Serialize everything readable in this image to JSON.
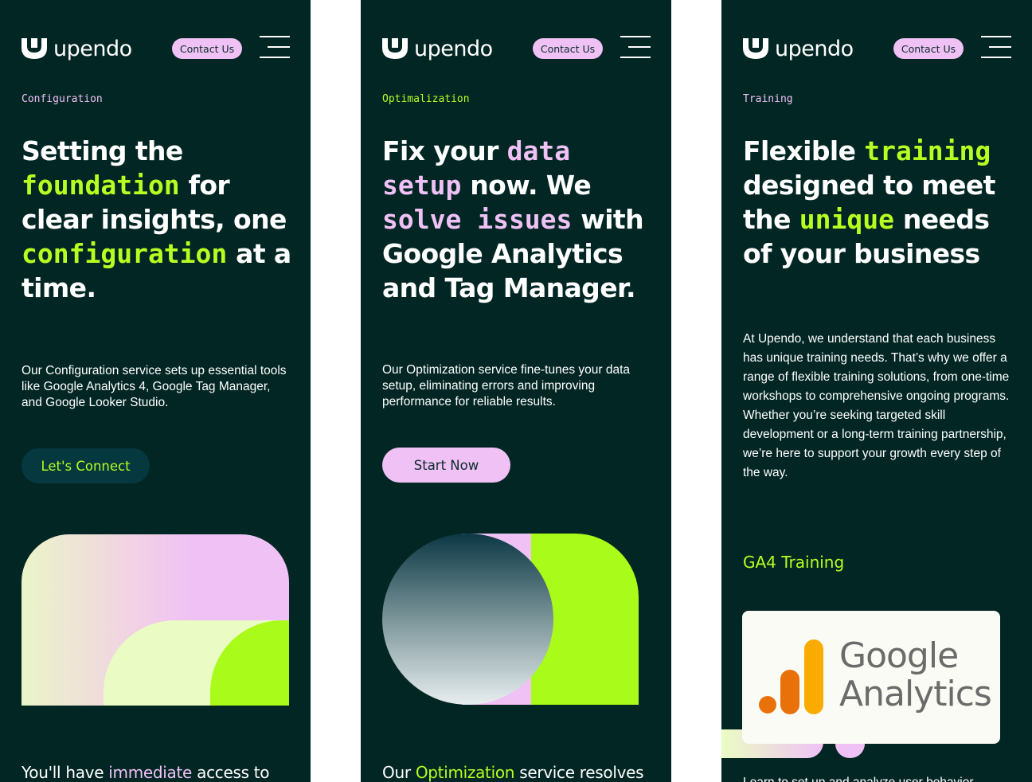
{
  "brand": {
    "name": "upendo",
    "contact_label": "Contact Us"
  },
  "colors": {
    "background": "#022624",
    "accent_green": "#b6ff20",
    "accent_pink": "#efc1f5",
    "button_dark": "#06383f"
  },
  "panels": [
    {
      "label": "Configuration",
      "headline": [
        {
          "text": "Setting the ",
          "style": "plain"
        },
        {
          "text": "foundation",
          "style": "mono-green"
        },
        {
          "text": " for clear insights, one ",
          "style": "plain"
        },
        {
          "text": "configuration",
          "style": "mono-green"
        },
        {
          "text": " at a time.",
          "style": "plain"
        }
      ],
      "body": "Our Configuration service sets up essential tools like Google Analytics 4, Google Tag Manager, and Google Looker Studio.",
      "button": "Let's Connect",
      "footer": {
        "pre": "You'll have ",
        "highlight": "immediate",
        "post": " access to"
      }
    },
    {
      "label": "Optimalization",
      "headline": [
        {
          "text": "Fix your ",
          "style": "plain"
        },
        {
          "text": "data setup",
          "style": "mono-pink"
        },
        {
          "text": " now. We ",
          "style": "plain"
        },
        {
          "text": "solve issues",
          "style": "mono-pink"
        },
        {
          "text": " with Google Analytics and Tag Manager.",
          "style": "plain"
        }
      ],
      "body": "Our Optimization service fine-tunes your data setup, eliminating errors and improving performance for reliable results.",
      "button": "Start Now",
      "footer": {
        "pre": "Our ",
        "highlight": "Optimization",
        "post": " service resolves"
      }
    },
    {
      "label": "Training",
      "headline": [
        {
          "text": "Flexible ",
          "style": "plain"
        },
        {
          "text": "training",
          "style": "mono-green"
        },
        {
          "text": " designed to meet the ",
          "style": "plain"
        },
        {
          "text": "unique",
          "style": "mono-green"
        },
        {
          "text": " needs of your business",
          "style": "plain"
        }
      ],
      "body": "At Upendo, we understand that each business has unique training needs. That’s why we offer a range of flexible training solutions, from one-time workshops to comprehensive ongoing programs. Whether you’re seeking targeted skill development or a long-term training partnership, we’re here to support your growth every step of the way.",
      "section_title": "GA4 Training",
      "ga_logo": {
        "line1": "Google",
        "line2": "Analytics"
      },
      "footer_partial": "Learn to set up and analyze user behavior"
    }
  ],
  "icons": [
    "upendo-logo-icon",
    "hamburger-menu-icon",
    "google-analytics-logo-icon"
  ]
}
